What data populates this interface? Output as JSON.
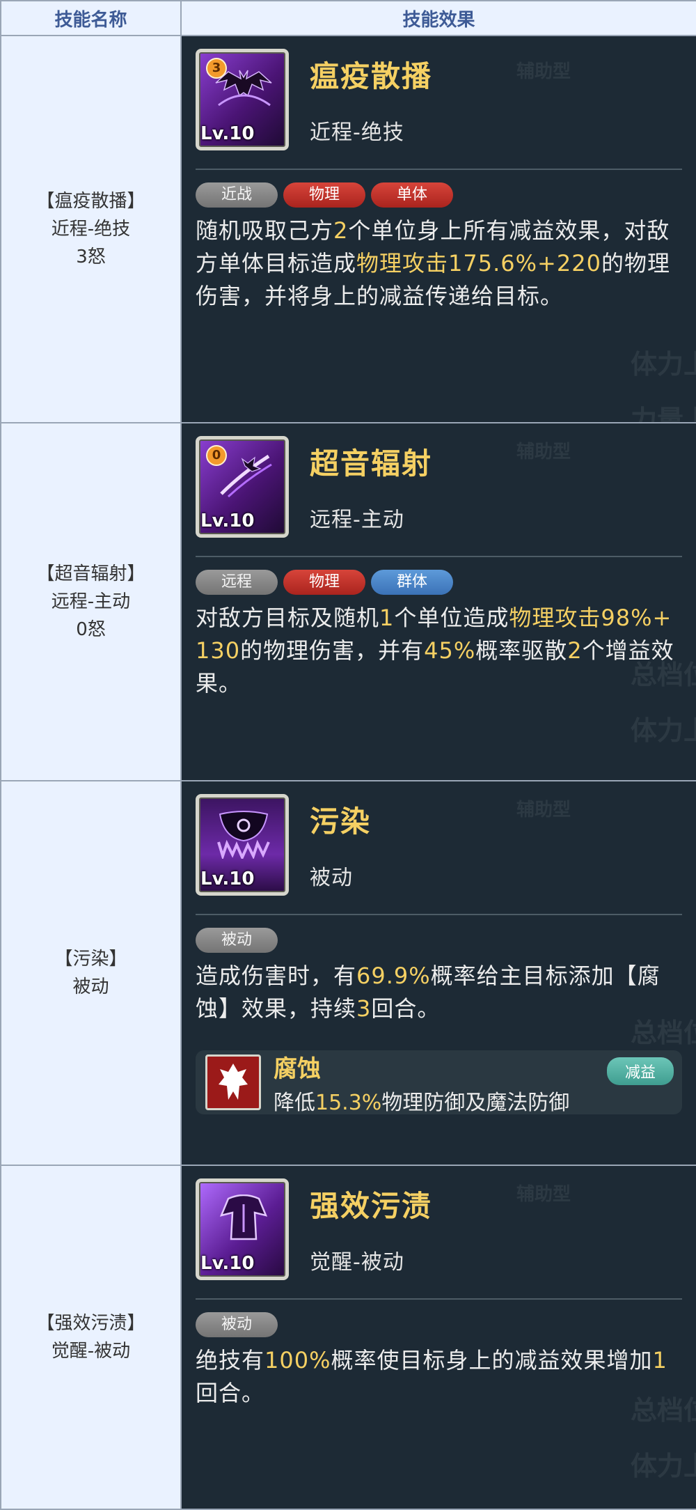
{
  "headers": {
    "col1": "技能名称",
    "col2": "技能效果"
  },
  "bg_watermark": {
    "a": "辅助型",
    "b": "体力上",
    "c": "力量上",
    "d": "总档位"
  },
  "rows": [
    {
      "left": {
        "name": "【瘟疫散播】",
        "type": "近程-绝技",
        "cost": "3怒"
      },
      "icon_level": "Lv.10",
      "icon_cost": "3",
      "skill_name": "瘟疫散播",
      "skill_type": "近程-绝技",
      "tags": [
        {
          "text": "近战",
          "color": "gray"
        },
        {
          "text": "物理",
          "color": "red"
        },
        {
          "text": "单体",
          "color": "red"
        }
      ],
      "desc": {
        "p1": "随机吸取己方",
        "h1": "2",
        "p2": "个单位身上所有减益效果，对敌方单体目标造成",
        "h2": "物理攻击175.6%+220",
        "p3": "的物理伤害，并将身上的减益传递给目标。"
      }
    },
    {
      "left": {
        "name": "【超音辐射】",
        "type": "远程-主动",
        "cost": "0怒"
      },
      "icon_level": "Lv.10",
      "icon_cost": "0",
      "skill_name": "超音辐射",
      "skill_type": "远程-主动",
      "tags": [
        {
          "text": "远程",
          "color": "gray"
        },
        {
          "text": "物理",
          "color": "red"
        },
        {
          "text": "群体",
          "color": "blue"
        }
      ],
      "desc": {
        "p1": "对敌方目标及随机",
        "h1": "1",
        "p2": "个单位造成",
        "h2": "物理攻击98%+130",
        "p3": "的物理伤害，并有",
        "h3": "45%",
        "p4": "概率驱散",
        "h4": "2",
        "p5": "个增益效果。"
      }
    },
    {
      "left": {
        "name": "【污染】",
        "type": "被动"
      },
      "icon_level": "Lv.10",
      "skill_name": "污染",
      "skill_type": "被动",
      "tags": [
        {
          "text": "被动",
          "color": "gray"
        }
      ],
      "desc": {
        "p1": "造成伤害时，有",
        "h1": "69.9%",
        "p2": "概率给主目标添加【腐蚀】效果，持续",
        "h2": "3",
        "p3": "回合。"
      },
      "buff": {
        "name": "腐蚀",
        "badge": "减益",
        "d1": "降低",
        "dh": "15.3%",
        "d2": "物理防御及魔法防御"
      }
    },
    {
      "left": {
        "name": "【强效污渍】",
        "type": "觉醒-被动"
      },
      "icon_level": "Lv.10",
      "skill_name": "强效污渍",
      "skill_type": "觉醒-被动",
      "tags": [
        {
          "text": "被动",
          "color": "gray"
        }
      ],
      "desc": {
        "p1": "绝技有",
        "h1": "100%",
        "p2": "概率使目标身上的减益效果增加",
        "h2": "1",
        "p3": "回合。"
      }
    }
  ]
}
